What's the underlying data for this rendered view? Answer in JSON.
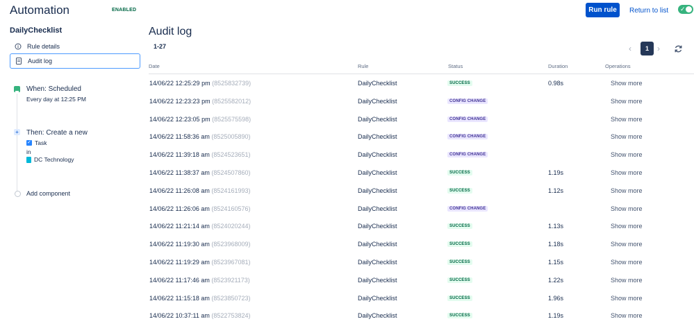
{
  "header": {
    "title": "Automation",
    "badge": "ENABLED",
    "run_label": "Run rule",
    "return_label": "Return to list",
    "toggle_on": true
  },
  "sidebar": {
    "rule_name": "DailyChecklist",
    "items": [
      {
        "label": "Rule details",
        "icon": "info-icon"
      },
      {
        "label": "Audit log",
        "icon": "document-icon",
        "active": true
      }
    ],
    "trigger": {
      "title": "When: Scheduled",
      "subtitle": "Every day at 12:25 PM"
    },
    "action": {
      "title": "Then: Create a new",
      "issue_type": "Task",
      "in_label": "in",
      "project": "DC Technology"
    },
    "add_component": "Add component"
  },
  "main": {
    "title": "Audit log",
    "count": "1-27",
    "pagination": {
      "current": "1",
      "prev": "‹",
      "next": "›"
    },
    "columns": {
      "date": "Date",
      "rule": "Rule",
      "status": "Status",
      "duration": "Duration",
      "operations": "Operations"
    },
    "rows": [
      {
        "date": "14/06/22 12:25:29 pm",
        "exec": "(8525832739)",
        "rule": "DailyChecklist",
        "status": "SUCCESS",
        "duration": "0.98s",
        "op": "Show more"
      },
      {
        "date": "14/06/22 12:23:23 pm",
        "exec": "(8525582012)",
        "rule": "DailyChecklist",
        "status": "CONFIG CHANGE",
        "duration": "",
        "op": "Show more"
      },
      {
        "date": "14/06/22 12:23:05 pm",
        "exec": "(8525575598)",
        "rule": "DailyChecklist",
        "status": "CONFIG CHANGE",
        "duration": "",
        "op": "Show more"
      },
      {
        "date": "14/06/22 11:58:36 am",
        "exec": "(8525005890)",
        "rule": "DailyChecklist",
        "status": "CONFIG CHANGE",
        "duration": "",
        "op": "Show more"
      },
      {
        "date": "14/06/22 11:39:18 am",
        "exec": "(8524523651)",
        "rule": "DailyChecklist",
        "status": "CONFIG CHANGE",
        "duration": "",
        "op": "Show more"
      },
      {
        "date": "14/06/22 11:38:37 am",
        "exec": "(8524507860)",
        "rule": "DailyChecklist",
        "status": "SUCCESS",
        "duration": "1.19s",
        "op": "Show more"
      },
      {
        "date": "14/06/22 11:26:08 am",
        "exec": "(8524161993)",
        "rule": "DailyChecklist",
        "status": "SUCCESS",
        "duration": "1.12s",
        "op": "Show more"
      },
      {
        "date": "14/06/22 11:26:06 am",
        "exec": "(8524160576)",
        "rule": "DailyChecklist",
        "status": "CONFIG CHANGE",
        "duration": "",
        "op": "Show more"
      },
      {
        "date": "14/06/22 11:21:14 am",
        "exec": "(8524020244)",
        "rule": "DailyChecklist",
        "status": "SUCCESS",
        "duration": "1.13s",
        "op": "Show more"
      },
      {
        "date": "14/06/22 11:19:30 am",
        "exec": "(8523968009)",
        "rule": "DailyChecklist",
        "status": "SUCCESS",
        "duration": "1.18s",
        "op": "Show more"
      },
      {
        "date": "14/06/22 11:19:29 am",
        "exec": "(8523967081)",
        "rule": "DailyChecklist",
        "status": "SUCCESS",
        "duration": "1.15s",
        "op": "Show more"
      },
      {
        "date": "14/06/22 11:17:46 am",
        "exec": "(8523921173)",
        "rule": "DailyChecklist",
        "status": "SUCCESS",
        "duration": "1.22s",
        "op": "Show more"
      },
      {
        "date": "14/06/22 11:15:18 am",
        "exec": "(8523850723)",
        "rule": "DailyChecklist",
        "status": "SUCCESS",
        "duration": "1.96s",
        "op": "Show more"
      },
      {
        "date": "14/06/22 10:37:11 am",
        "exec": "(8522753824)",
        "rule": "DailyChecklist",
        "status": "SUCCESS",
        "duration": "1.19s",
        "op": "Show more"
      }
    ]
  },
  "colors": {
    "primary": "#0052cc",
    "success_bg": "#e3fcef",
    "success_fg": "#006644",
    "config_bg": "#eae6ff",
    "config_fg": "#403294",
    "toggle": "#36b37e"
  }
}
